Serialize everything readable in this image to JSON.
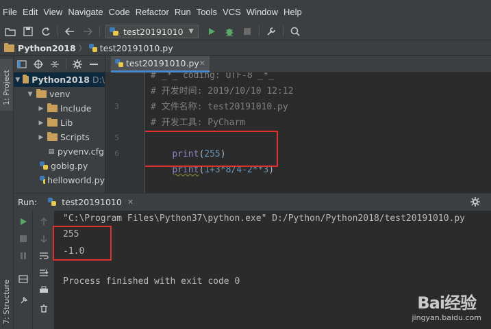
{
  "menu": [
    "File",
    "Edit",
    "View",
    "Navigate",
    "Code",
    "Refactor",
    "Run",
    "Tools",
    "VCS",
    "Window",
    "Help"
  ],
  "toolbar": {
    "run_config": "test20191010"
  },
  "breadcrumb": {
    "project": "Python2018",
    "file": "test20191010.py"
  },
  "left_strip": {
    "project_label": "1: Project",
    "structure_label": "7: Structure"
  },
  "project_tree": {
    "root": "Python2018",
    "root_path": "D:\\",
    "items": [
      "venv",
      "Include",
      "Lib",
      "Scripts",
      "pyvenv.cfg",
      "gobig.py",
      "helloworld.py"
    ]
  },
  "editor": {
    "tab": "test20191010.py",
    "line_numbers": [
      "",
      "",
      "3",
      "",
      "5",
      "6"
    ],
    "lines": [
      "# _*_ coding: UTF-8 _*_",
      "# 开发时间: 2019/10/10 12:12",
      "# 文件名称: test20191010.py",
      "# 开发工具: PyCharm",
      "print(255)",
      "print(1+3*8/4-2**3)"
    ],
    "line5": {
      "func": "print",
      "open": "(",
      "arg": "255",
      "close": ")"
    },
    "line6": {
      "func": "print",
      "open": "(",
      "arg": "1+3*8/4-2**3",
      "close": ")"
    }
  },
  "run": {
    "label": "Run:",
    "tab": "test20191010",
    "command": "\"C:\\Program Files\\Python37\\python.exe\" D:/Python/Python2018/test20191010.py",
    "output": [
      "255",
      "-1.0"
    ],
    "exit": "Process finished with exit code 0"
  },
  "watermark": {
    "logo": "Bai经验",
    "url": "jingyan.baidu.com"
  },
  "colors": {
    "accent": "#4a88c7",
    "highlight_box": "#e03030",
    "run_green": "#59a869"
  }
}
